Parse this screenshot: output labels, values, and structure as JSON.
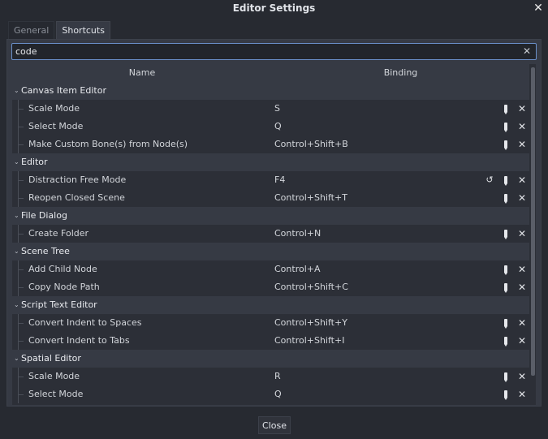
{
  "window": {
    "title": "Editor Settings",
    "close_icon": "close-icon",
    "close_glyph": "✕"
  },
  "tabs": [
    {
      "label": "General",
      "active": false
    },
    {
      "label": "Shortcuts",
      "active": true
    }
  ],
  "search": {
    "value": "code",
    "clear_glyph": "✕"
  },
  "columns": {
    "name": "Name",
    "binding": "Binding"
  },
  "glyphs": {
    "chevron": "⌄",
    "revert": "↺",
    "clear": "✕"
  },
  "categories": [
    {
      "label": "Canvas Item Editor",
      "items": [
        {
          "name": "Scale Mode",
          "binding": "S"
        },
        {
          "name": "Select Mode",
          "binding": "Q"
        },
        {
          "name": "Make Custom Bone(s) from Node(s)",
          "binding": "Control+Shift+B"
        }
      ]
    },
    {
      "label": "Editor",
      "items": [
        {
          "name": "Distraction Free Mode",
          "binding": "F4",
          "revert": true
        },
        {
          "name": "Reopen Closed Scene",
          "binding": "Control+Shift+T"
        }
      ]
    },
    {
      "label": "File Dialog",
      "items": [
        {
          "name": "Create Folder",
          "binding": "Control+N"
        }
      ]
    },
    {
      "label": "Scene Tree",
      "items": [
        {
          "name": "Add Child Node",
          "binding": "Control+A"
        },
        {
          "name": "Copy Node Path",
          "binding": "Control+Shift+C"
        }
      ]
    },
    {
      "label": "Script Text Editor",
      "items": [
        {
          "name": "Convert Indent to Spaces",
          "binding": "Control+Shift+Y"
        },
        {
          "name": "Convert Indent to Tabs",
          "binding": "Control+Shift+I"
        }
      ]
    },
    {
      "label": "Spatial Editor",
      "items": [
        {
          "name": "Scale Mode",
          "binding": "R"
        },
        {
          "name": "Select Mode",
          "binding": "Q"
        }
      ]
    }
  ],
  "footer": {
    "close_label": "Close"
  }
}
